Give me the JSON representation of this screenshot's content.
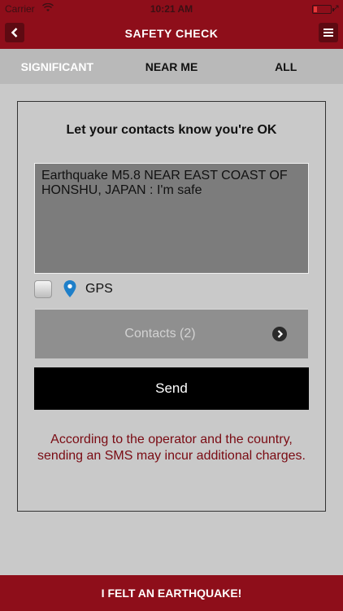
{
  "status_bar": {
    "carrier": "Carrier",
    "wifi_icon": "wifi-icon",
    "time": "10:21 AM",
    "battery_icon": "battery-icon",
    "battery_level_fraction": 0.15,
    "battery_color": "#e53a3a"
  },
  "nav": {
    "title": "SAFETY CHECK",
    "back_icon": "chevron-left-icon",
    "menu_icon": "hamburger-menu-icon"
  },
  "tabs": [
    {
      "label": "SIGNIFICANT",
      "active": true
    },
    {
      "label": "NEAR ME",
      "active": false
    },
    {
      "label": "ALL",
      "active": false
    }
  ],
  "card": {
    "title": "Let your contacts know you're OK",
    "message": "Earthquake M5.8 NEAR EAST COAST OF HONSHU, JAPAN : I'm safe",
    "gps_checked": false,
    "gps_label": "GPS",
    "contacts_label": "Contacts (2)",
    "send_label": "Send",
    "warning": "According to the operator and the country, sending an SMS may incur additional charges."
  },
  "bottom": {
    "label": "I FELT AN EARTHQUAKE!"
  },
  "colors": {
    "brand": "#8e0e1a",
    "warning_text": "#7a0b13",
    "background": "#c9c9c9"
  }
}
